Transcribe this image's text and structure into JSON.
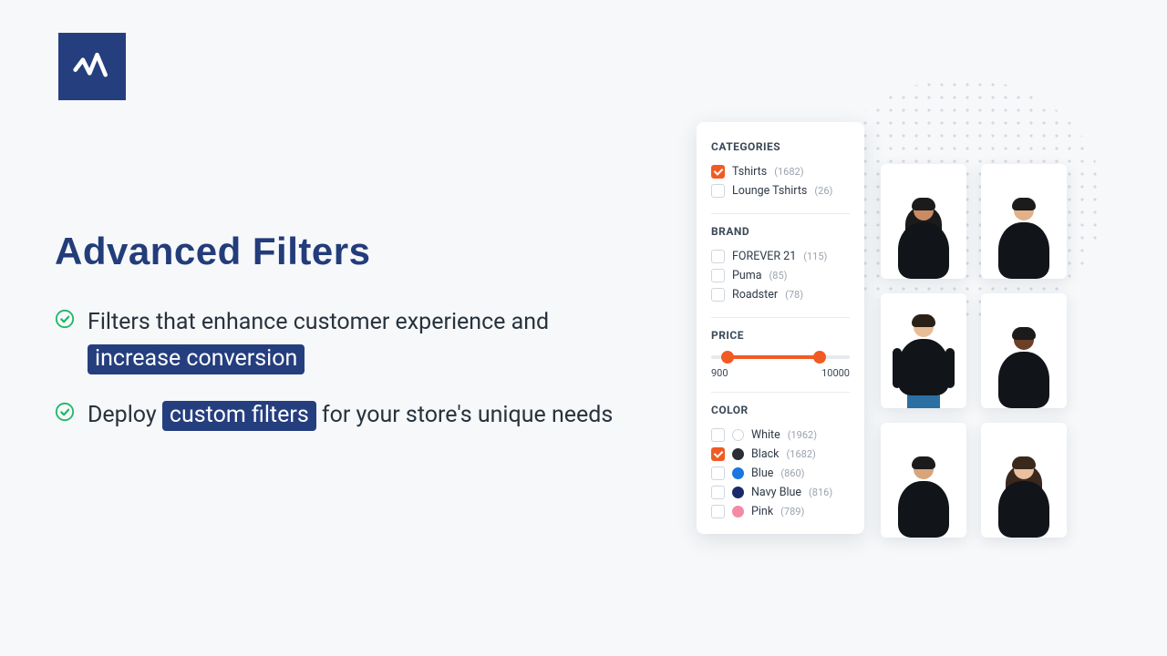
{
  "hero": {
    "title": "Advanced Filters",
    "bullets": [
      {
        "pre": "Filters that enhance customer experience and ",
        "hl": "increase conversion",
        "post": ""
      },
      {
        "pre": "Deploy ",
        "hl": "custom filters",
        "post": " for your store's unique needs"
      }
    ]
  },
  "colors": {
    "brand": "#253e7e",
    "accent": "#f15a24",
    "check_green": "#1fb866"
  },
  "panel": {
    "sections": {
      "categories": {
        "title": "CATEGORIES",
        "items": [
          {
            "label": "Tshirts",
            "count": "(1682)",
            "checked": true
          },
          {
            "label": "Lounge Tshirts",
            "count": "(26)",
            "checked": false
          }
        ]
      },
      "brand": {
        "title": "BRAND",
        "items": [
          {
            "label": "FOREVER 21",
            "count": "(115)",
            "checked": false
          },
          {
            "label": "Puma",
            "count": "(85)",
            "checked": false
          },
          {
            "label": "Roadster",
            "count": "(78)",
            "checked": false
          }
        ]
      },
      "price": {
        "title": "PRICE",
        "min": "900",
        "max": "10000",
        "low_pct": 12,
        "high_pct": 78
      },
      "color": {
        "title": "COLOR",
        "items": [
          {
            "label": "White",
            "count": "(1962)",
            "swatch": "#ffffff",
            "border": "#cfd6de",
            "checked": false
          },
          {
            "label": "Black",
            "count": "(1682)",
            "swatch": "#2a2f36",
            "border": "#2a2f36",
            "checked": true
          },
          {
            "label": "Blue",
            "count": "(860)",
            "swatch": "#1a77e2",
            "border": "#1a77e2",
            "checked": false
          },
          {
            "label": "Navy Blue",
            "count": "(816)",
            "swatch": "#1a2a6a",
            "border": "#1a2a6a",
            "checked": false
          },
          {
            "label": "Pink",
            "count": "(789)",
            "swatch": "#f48aa6",
            "border": "#f48aa6",
            "checked": false
          }
        ]
      }
    }
  },
  "grid": {
    "products": [
      {
        "skin": "#c98b64",
        "hair_color": "#1b1b1b",
        "long_hair": true,
        "long_sleeve": false,
        "pants": false
      },
      {
        "skin": "#e2b188",
        "hair_color": "#1b1b1b",
        "long_hair": false,
        "long_sleeve": false,
        "pants": false
      },
      {
        "skin": "#e8bd96",
        "hair_color": "#2a2016",
        "long_hair": false,
        "long_sleeve": true,
        "pants": true
      },
      {
        "skin": "#6b3f28",
        "hair_color": "#1b1b1b",
        "long_hair": false,
        "long_sleeve": false,
        "pants": false
      },
      {
        "skin": "#d9a47a",
        "hair_color": "#1b1b1b",
        "long_hair": false,
        "long_sleeve": false,
        "pants": false
      },
      {
        "skin": "#e9c1a0",
        "hair_color": "#3a281d",
        "long_hair": true,
        "long_sleeve": false,
        "pants": false
      }
    ]
  }
}
